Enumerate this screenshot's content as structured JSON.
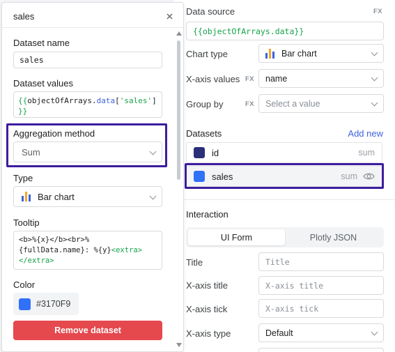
{
  "right": {
    "data_source": {
      "label": "Data source",
      "fx": "FX",
      "value": "{{objectOfArrays.data}}"
    },
    "chart_type": {
      "label": "Chart type",
      "value": "Bar chart"
    },
    "x_axis_values": {
      "label": "X-axis values",
      "fx": "FX",
      "value": "name"
    },
    "group_by": {
      "label": "Group by",
      "fx": "FX",
      "placeholder": "Select a value"
    },
    "datasets": {
      "title": "Datasets",
      "add_new": "Add new",
      "items": [
        {
          "name": "id",
          "aggregation": "sum",
          "color": "#2b2f7a"
        },
        {
          "name": "sales",
          "aggregation": "sum",
          "color": "#3170F9"
        }
      ]
    },
    "interaction": {
      "title": "Interaction",
      "tabs": [
        "UI Form",
        "Plotly JSON"
      ],
      "fields": [
        {
          "label": "Title",
          "placeholder": "Title"
        },
        {
          "label": "X-axis title",
          "placeholder": "X-axis title"
        },
        {
          "label": "X-axis tick",
          "placeholder": "X-axis tick"
        },
        {
          "label": "X-axis type",
          "value": "Default"
        }
      ]
    }
  },
  "left": {
    "title": "sales",
    "dataset_name": {
      "label": "Dataset name",
      "value": "sales"
    },
    "dataset_values": {
      "label": "Dataset values",
      "line1_open": "{{",
      "line1_obj": "objectOfArrays",
      "line1_dot": ".",
      "line1_prop": "data",
      "line1_br_open": "[",
      "line1_str": "'sales'",
      "line1_br_close": "]",
      "line2": "}}"
    },
    "aggregation": {
      "label": "Aggregation method",
      "value": "Sum"
    },
    "type": {
      "label": "Type",
      "value": "Bar chart"
    },
    "tooltip": {
      "label": "Tooltip",
      "line1": "<b>%{x}</b><br>%",
      "line2_text": "{fullData.name}: %{y}",
      "line2_tag": "<extra>",
      "line3_tag": "</extra>"
    },
    "color": {
      "label": "Color",
      "value": "#3170F9",
      "hex": "#3170F9"
    },
    "remove_button": "Remove dataset"
  },
  "colors": {
    "highlight": "#3c1d9e",
    "remove": "#e5484d",
    "link": "#3e63dd",
    "code_green": "#16a34a",
    "code_blue": "#3e63dd"
  }
}
